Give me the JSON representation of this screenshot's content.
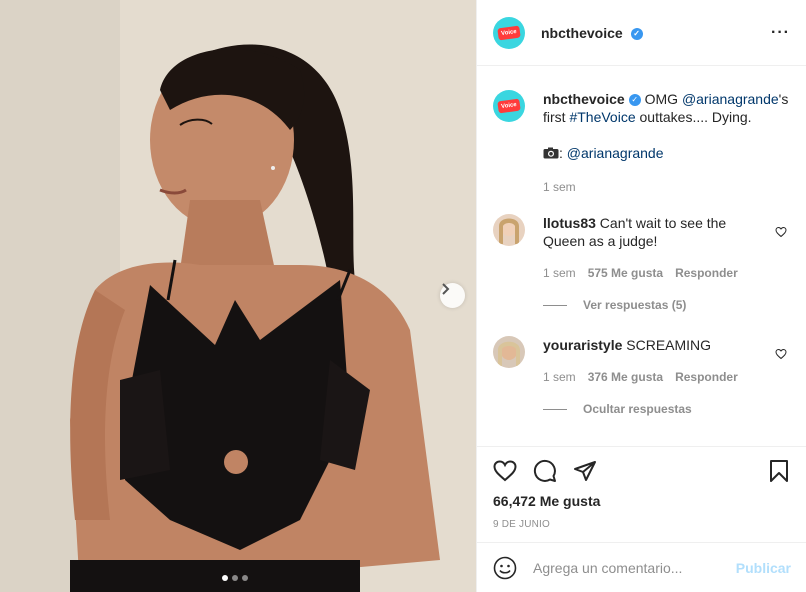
{
  "post": {
    "username": "nbcthevoice",
    "more_icon": "more-horizontal-icon"
  },
  "caption": {
    "username": "nbcthevoice",
    "text_1": "OMG ",
    "mention": "@arianagrande",
    "text_2": "'s first ",
    "hashtag": "#TheVoice",
    "text_3": " outtakes.... Dying.",
    "camera_icon": "camera-icon",
    "credit_sep": ": ",
    "credit": "@arianagrande",
    "time": "1 sem"
  },
  "comments": [
    {
      "username": "llotus83",
      "text": "Can't wait to see the Queen as a judge!",
      "time": "1 sem",
      "likes": "575 Me gusta",
      "reply": "Responder",
      "replies_toggle": "Ver respuestas (5)"
    },
    {
      "username": "youraristyle",
      "text": "SCREAMING",
      "time": "1 sem",
      "likes": "376 Me gusta",
      "reply": "Responder",
      "replies_toggle": "Ocultar respuestas"
    }
  ],
  "actions": {
    "likes": "66,472 Me gusta",
    "date": "9 DE JUNIO"
  },
  "add_comment": {
    "placeholder": "Agrega un comentario...",
    "publish": "Publicar"
  },
  "colors": {
    "verified": "#3897f0",
    "link": "#00376b",
    "publish_disabled": "#b2dffc",
    "avatar_bg": "#3ad6e0"
  },
  "carousel": {
    "slides": 3,
    "active": 1
  }
}
